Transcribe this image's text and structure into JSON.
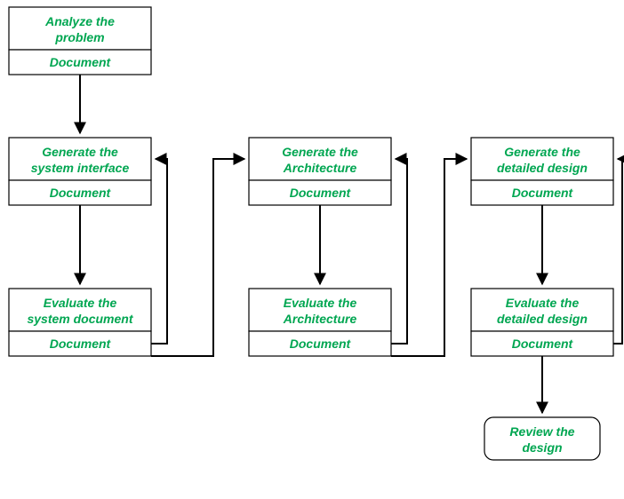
{
  "colors": {
    "text": "#00a651",
    "stroke": "#000000",
    "background": "#ffffff"
  },
  "nodes": {
    "analyze": {
      "title1": "Analyze the",
      "title2": "problem",
      "sub": "Document"
    },
    "gen_interface": {
      "title1": "Generate the",
      "title2": "system interface",
      "sub": "Document"
    },
    "gen_arch": {
      "title1": "Generate the",
      "title2": "Architecture",
      "sub": "Document"
    },
    "gen_detail": {
      "title1": "Generate the",
      "title2": "detailed design",
      "sub": "Document"
    },
    "eval_sysdoc": {
      "title1": "Evaluate the",
      "title2": "system document",
      "sub": "Document"
    },
    "eval_arch": {
      "title1": "Evaluate the",
      "title2": "Architecture",
      "sub": "Document"
    },
    "eval_detail": {
      "title1": "Evaluate the",
      "title2": "detailed design",
      "sub": "Document"
    },
    "review": {
      "title1": "Review the",
      "title2": "design"
    }
  },
  "chart_data": {
    "type": "flowchart",
    "title": "",
    "nodes": [
      {
        "id": "analyze",
        "label": "Analyze the problem",
        "sub": "Document",
        "shape": "rect-sub"
      },
      {
        "id": "gen_interface",
        "label": "Generate the system interface",
        "sub": "Document",
        "shape": "rect-sub"
      },
      {
        "id": "gen_arch",
        "label": "Generate the Architecture",
        "sub": "Document",
        "shape": "rect-sub"
      },
      {
        "id": "gen_detail",
        "label": "Generate the detailed design",
        "sub": "Document",
        "shape": "rect-sub"
      },
      {
        "id": "eval_sysdoc",
        "label": "Evaluate the system document",
        "sub": "Document",
        "shape": "rect-sub"
      },
      {
        "id": "eval_arch",
        "label": "Evaluate the Architecture",
        "sub": "Document",
        "shape": "rect-sub"
      },
      {
        "id": "eval_detail",
        "label": "Evaluate the detailed design",
        "sub": "Document",
        "shape": "rect-sub"
      },
      {
        "id": "review",
        "label": "Review the design",
        "shape": "rounded-rect"
      }
    ],
    "edges": [
      {
        "from": "analyze",
        "to": "gen_interface"
      },
      {
        "from": "gen_interface",
        "to": "eval_sysdoc"
      },
      {
        "from": "eval_sysdoc",
        "to": "gen_interface",
        "kind": "feedback"
      },
      {
        "from": "eval_sysdoc",
        "to": "gen_arch",
        "kind": "forward"
      },
      {
        "from": "gen_arch",
        "to": "eval_arch"
      },
      {
        "from": "eval_arch",
        "to": "gen_arch",
        "kind": "feedback"
      },
      {
        "from": "eval_arch",
        "to": "gen_detail",
        "kind": "forward"
      },
      {
        "from": "gen_detail",
        "to": "eval_detail"
      },
      {
        "from": "eval_detail",
        "to": "gen_detail",
        "kind": "feedback"
      },
      {
        "from": "eval_detail",
        "to": "review"
      }
    ]
  }
}
